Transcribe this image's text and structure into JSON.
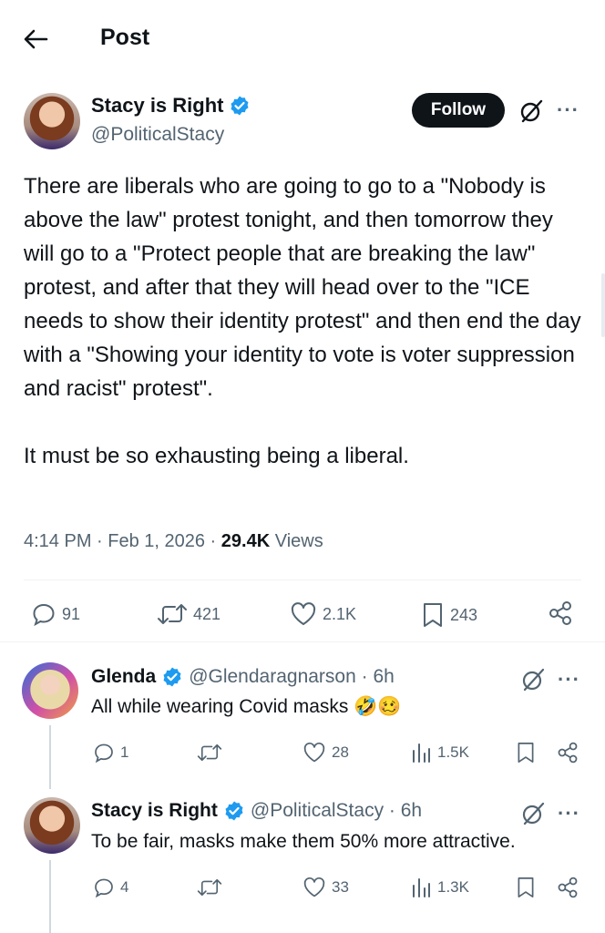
{
  "header": {
    "title": "Post"
  },
  "post": {
    "author_name": "Stacy is Right",
    "author_handle": "@PoliticalStacy",
    "follow_label": "Follow",
    "text": "There are liberals who are going to go to a \"Nobody is above the law\" protest tonight, and then tomorrow they will go to a \"Protect people that are breaking the law\" protest, and after that they will head over to the \"ICE needs to show their identity protest\" and then end the day with a \"Showing your identity to vote is voter suppression and racist\" protest\".",
    "text2": "It must be so exhausting being a liberal.",
    "time": "4:14 PM · Feb 1, 2026 · ",
    "views_count": "29.4K",
    "views_label": " Views",
    "stats": {
      "replies": "91",
      "reposts": "421",
      "likes": "2.1K",
      "bookmarks": "243"
    }
  },
  "replies": [
    {
      "name": "Glenda",
      "handle": "@Glendaragnarson · 6h",
      "text": "All while wearing Covid masks",
      "emoji": "🤣🥴",
      "stats": {
        "replies": "1",
        "reposts": "",
        "likes": "28",
        "views": "1.5K"
      }
    },
    {
      "name": "Stacy is Right",
      "handle": "@PoliticalStacy · 6h",
      "text": "To be fair, masks make them 50% more attractive.",
      "emoji": "",
      "stats": {
        "replies": "4",
        "reposts": "",
        "likes": "33",
        "views": "1.3K"
      }
    }
  ],
  "icons": [
    "back-arrow-icon",
    "verified-icon",
    "grok-icon",
    "more-icon",
    "reply-icon",
    "repost-icon",
    "like-icon",
    "bookmark-icon",
    "share-icon",
    "views-icon"
  ],
  "colors": {
    "verified": "#1d9bf0",
    "text": "#0f1419",
    "muted": "#536471",
    "follow_bg": "#0f1419"
  }
}
